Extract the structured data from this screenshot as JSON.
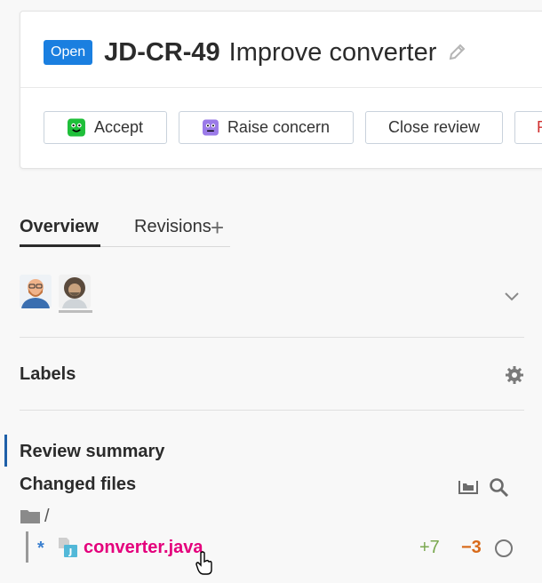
{
  "review": {
    "status_badge": "Open",
    "id": "JD-CR-49",
    "title": "Improve converter"
  },
  "actions": {
    "accept": "Accept",
    "raise_concern": "Raise concern",
    "close_review": "Close review",
    "reopen_partial": "R"
  },
  "tabs": {
    "overview": "Overview",
    "revisions": "Revisions",
    "add_icon": "+"
  },
  "participants": [
    "bald-bearded-avatar",
    "curly-hair-avatar"
  ],
  "sections": {
    "labels": "Labels",
    "review_summary": "Review summary",
    "changed_files": "Changed files"
  },
  "files": {
    "root": "/",
    "items": [
      {
        "marker": "*",
        "name": "converter.java",
        "added": "+7",
        "removed": "−3"
      }
    ]
  },
  "colors": {
    "badge": "#1a7fe0",
    "file_link": "#e4007c",
    "added": "#7aa84f",
    "removed": "#d86a1a",
    "reopen": "#d0302f"
  }
}
